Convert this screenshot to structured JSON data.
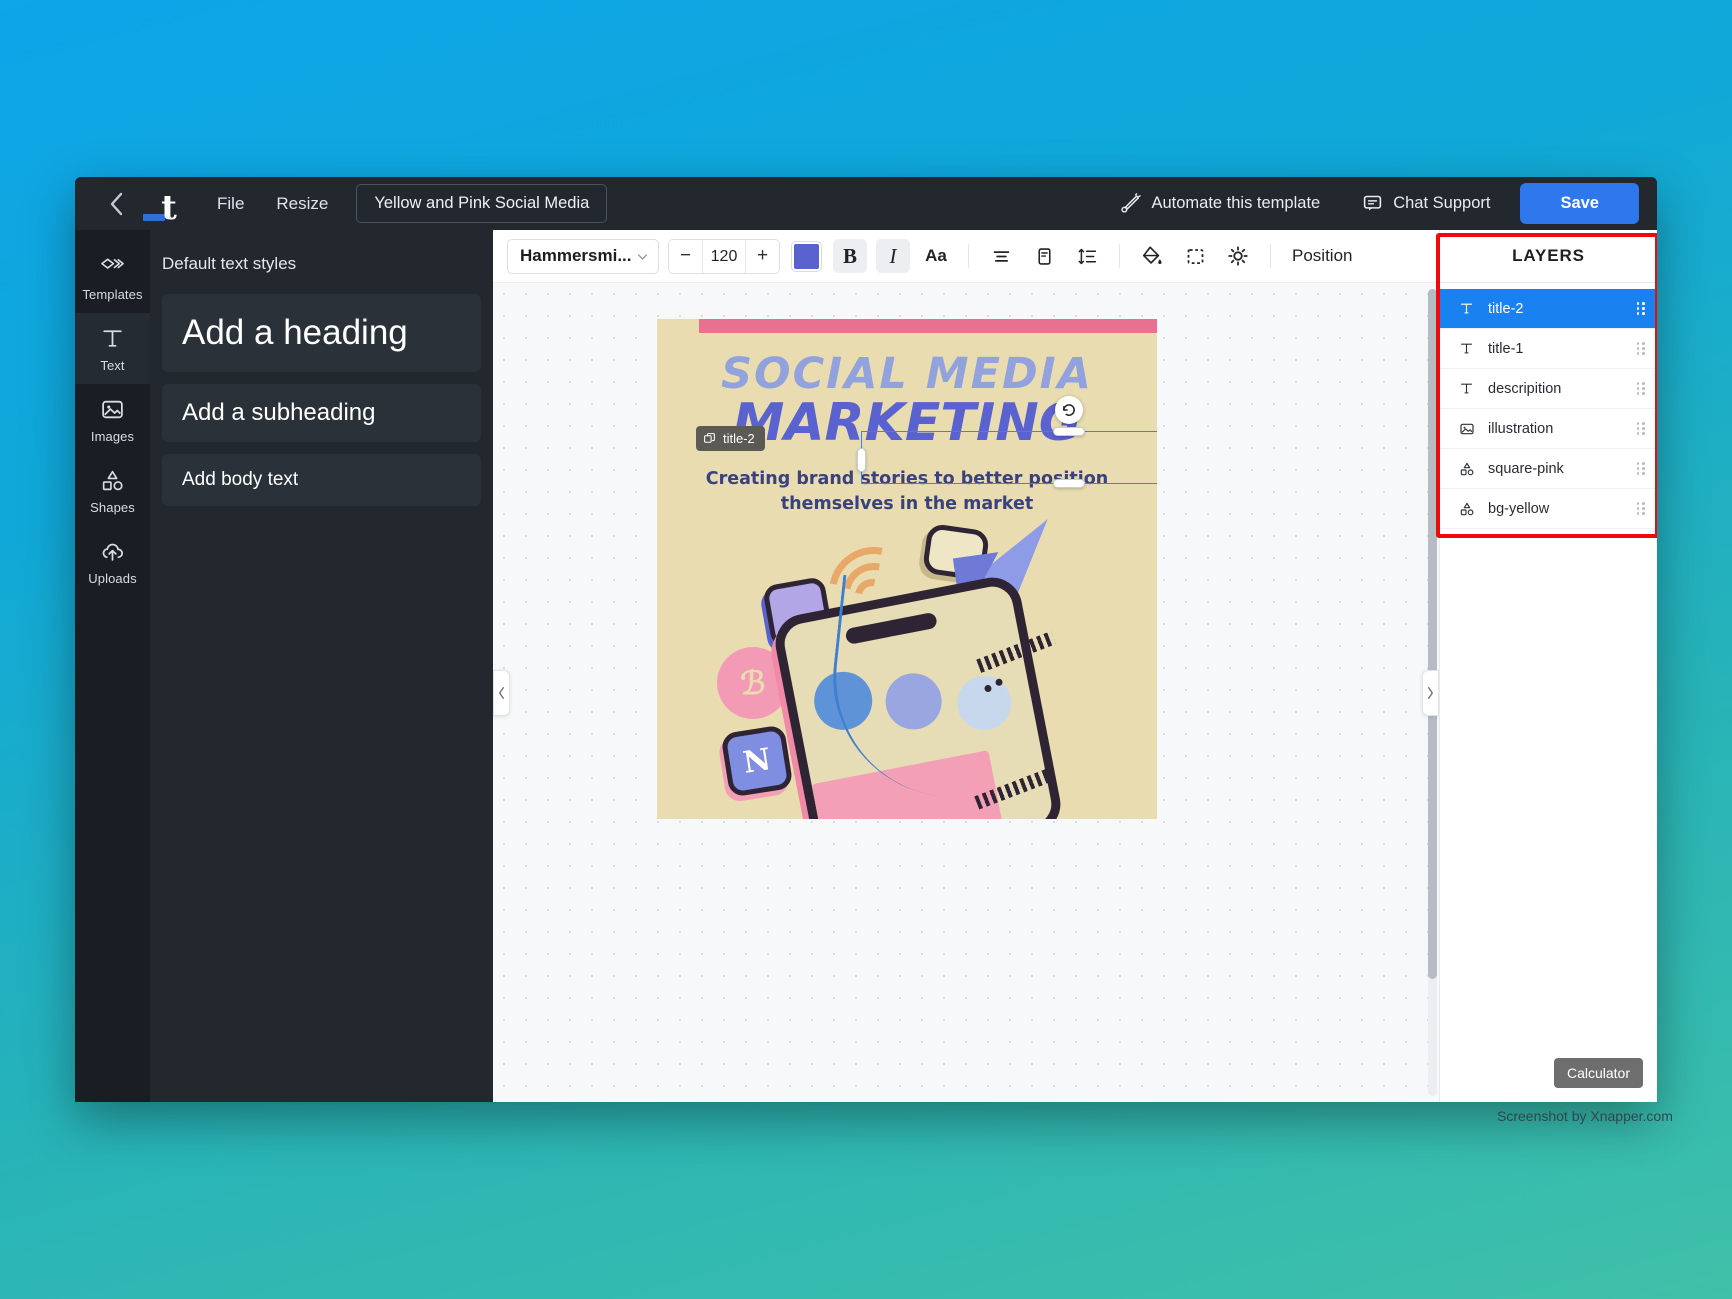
{
  "topbar": {
    "back_icon": "chevron-left-icon",
    "logo_letter": "t",
    "menus": [
      {
        "label": "File"
      },
      {
        "label": "Resize"
      }
    ],
    "document_title": "Yellow and Pink Social Media",
    "automate_label": "Automate this template",
    "automate_icon": "magic-wand-icon",
    "chat_label": "Chat Support",
    "chat_icon": "chat-bubble-icon",
    "save_label": "Save",
    "save_color": "#2f77ed"
  },
  "rail": {
    "items": [
      {
        "label": "Templates",
        "icon": "templates-icon",
        "active": false
      },
      {
        "label": "Text",
        "icon": "text-t-icon",
        "active": true
      },
      {
        "label": "Images",
        "icon": "image-icon",
        "active": false
      },
      {
        "label": "Shapes",
        "icon": "shapes-icon",
        "active": false
      },
      {
        "label": "Uploads",
        "icon": "upload-cloud-icon",
        "active": false
      }
    ]
  },
  "styles_panel": {
    "title": "Default text styles",
    "cards": [
      {
        "label": "Add a heading"
      },
      {
        "label": "Add a subheading"
      },
      {
        "label": "Add body text"
      }
    ]
  },
  "toolbar": {
    "font_name": "Hammersmi...",
    "font_dropdown_icon": "chevron-down-icon",
    "decrease_label": "−",
    "font_size": "120",
    "increase_label": "+",
    "text_color": "#5a62cf",
    "bold_label": "B",
    "italic_label": "I",
    "case_label": "Aa",
    "align_icon": "align-center-icon",
    "list_icon": "text-box-icon",
    "spacing_icon": "line-spacing-icon",
    "fill_icon": "paint-bucket-icon",
    "crop_icon": "selection-dashed-icon",
    "effects_icon": "brightness-icon",
    "position_label": "Position"
  },
  "design": {
    "title_line1": "SOCIAL MEDIA",
    "title_line2": "MARKETING",
    "description": "Creating brand stories to better position themselves in the market",
    "bg_color": "#e8dcb0",
    "accent_pink": "#e8718f",
    "title1_color": "#92a2dd",
    "title2_color": "#5a62cf",
    "badge_b": "ℬ",
    "badge_n": "N",
    "selected_layer_tag": "title-2",
    "layer_tag_icon": "copy-icon",
    "rotate_icon": "rotate-icon"
  },
  "canvas": {
    "collapse_left_icon": "chevron-left-icon",
    "collapse_right_icon": "chevron-right-icon"
  },
  "layers": {
    "title": "LAYERS",
    "items": [
      {
        "name": "title-2",
        "icon": "text-t-icon",
        "selected": true
      },
      {
        "name": "title-1",
        "icon": "text-t-icon",
        "selected": false
      },
      {
        "name": "descripition",
        "icon": "text-t-icon",
        "selected": false
      },
      {
        "name": "illustration",
        "icon": "image-icon",
        "selected": false
      },
      {
        "name": "square-pink",
        "icon": "shapes-icon",
        "selected": false
      },
      {
        "name": "bg-yellow",
        "icon": "shapes-icon",
        "selected": false
      }
    ],
    "highlight_color": "#f00b0b",
    "selected_color": "#1a82f0",
    "calculator_label": "Calculator"
  },
  "watermark": "Screenshot by Xnapper.com"
}
